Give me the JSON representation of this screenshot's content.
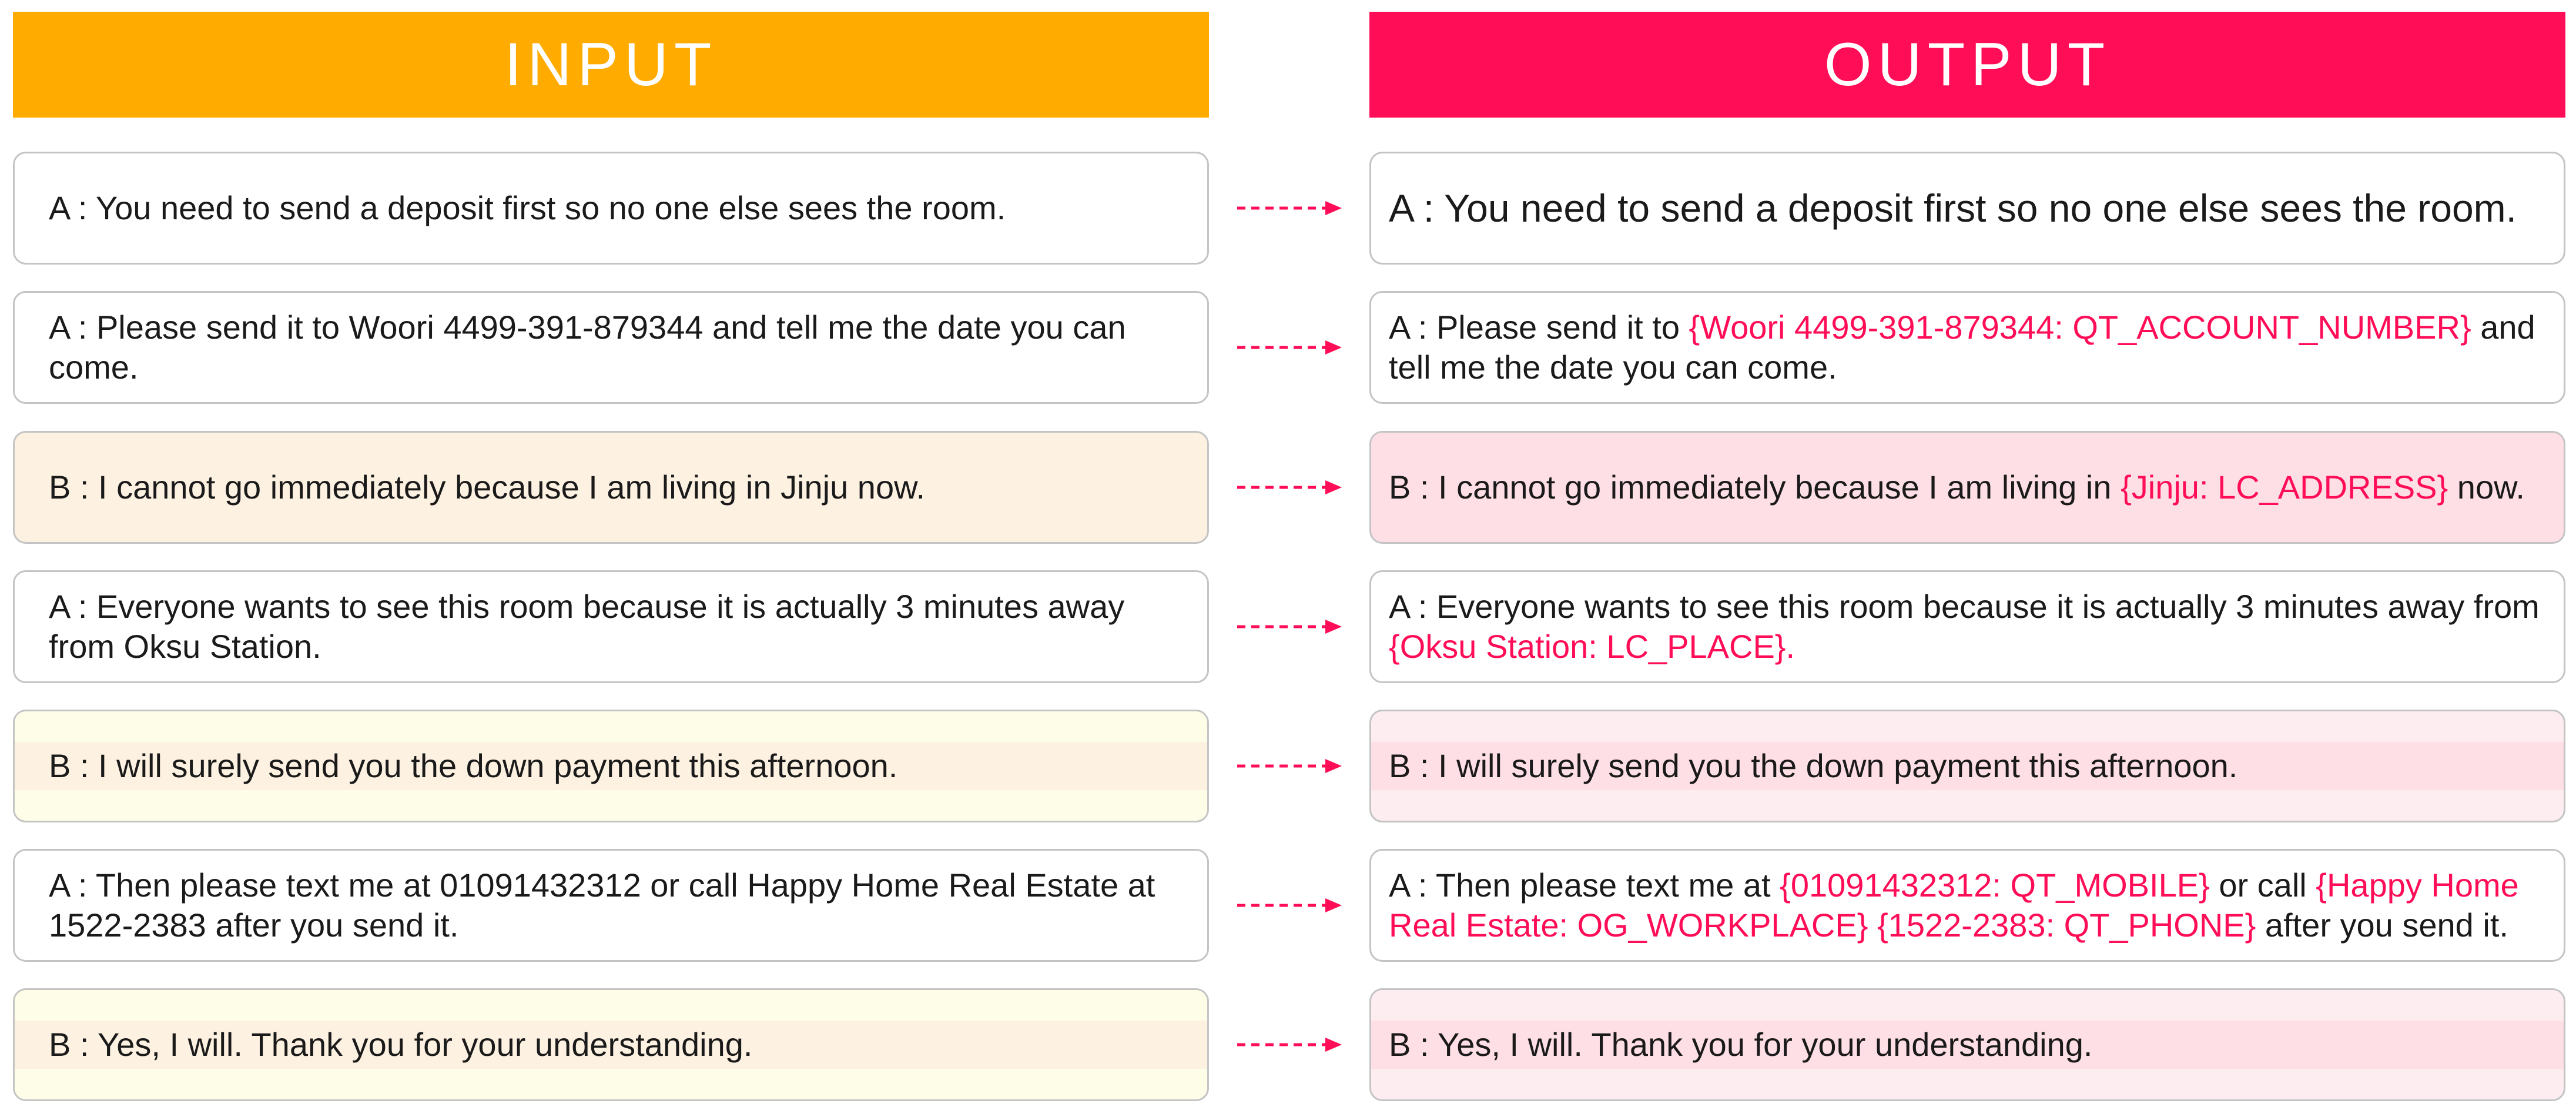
{
  "headers": {
    "input": "INPUT",
    "output": "OUTPUT"
  },
  "colors": {
    "input_header": "#FFAB00",
    "output_header": "#FF0D57",
    "highlight": "#FF0D57",
    "arrow": "#FF0D57"
  },
  "rows": [
    {
      "input": "A : You need to send a deposit first so no one else sees the room.",
      "output": [
        {
          "text": "A : You need to send a deposit first so no one else sees the room.",
          "hl": false
        }
      ]
    },
    {
      "input": "A : Please send it to Woori 4499-391-879344 and tell me the date you can come.",
      "output": [
        {
          "text": "A : Please send it to ",
          "hl": false
        },
        {
          "text": "{Woori 4499-391-879344: QT_ACCOUNT_NUMBER}",
          "hl": true
        },
        {
          "text": " and tell me the date you can come.",
          "hl": false
        }
      ]
    },
    {
      "input": "B : I cannot go immediately because I am living in Jinju now.",
      "output": [
        {
          "text": "B : I cannot go immediately because I am living in ",
          "hl": false
        },
        {
          "text": "{Jinju: LC_ADDRESS}",
          "hl": true
        },
        {
          "text": " now.",
          "hl": false
        }
      ]
    },
    {
      "input": "A : Everyone wants to see this room because it is actually 3 minutes away from Oksu Station.",
      "output": [
        {
          "text": "A : Everyone wants to see this room because it is actually 3 minutes away from ",
          "hl": false
        },
        {
          "text": "{Oksu Station: LC_PLACE}.",
          "hl": true
        }
      ]
    },
    {
      "input": "B : I will surely send you the down payment this afternoon.",
      "output": [
        {
          "text": "B : I will surely send you the down payment this afternoon.",
          "hl": false
        }
      ]
    },
    {
      "input": "A : Then please text me at 01091432312 or call Happy Home Real Estate at 1522-2383 after you send it.",
      "output": [
        {
          "text": "A : Then please text me at ",
          "hl": false
        },
        {
          "text": "{01091432312: QT_MOBILE}",
          "hl": true
        },
        {
          "text": " or call ",
          "hl": false
        },
        {
          "text": "{Happy Home Real Estate: OG_WORKPLACE} {1522-2383: QT_PHONE}",
          "hl": true
        },
        {
          "text": " after you send it.",
          "hl": false
        }
      ]
    },
    {
      "input": "B : Yes, I will. Thank you for your understanding.",
      "output": [
        {
          "text": "B : Yes, I will. Thank you for your understanding.",
          "hl": false
        }
      ]
    }
  ]
}
